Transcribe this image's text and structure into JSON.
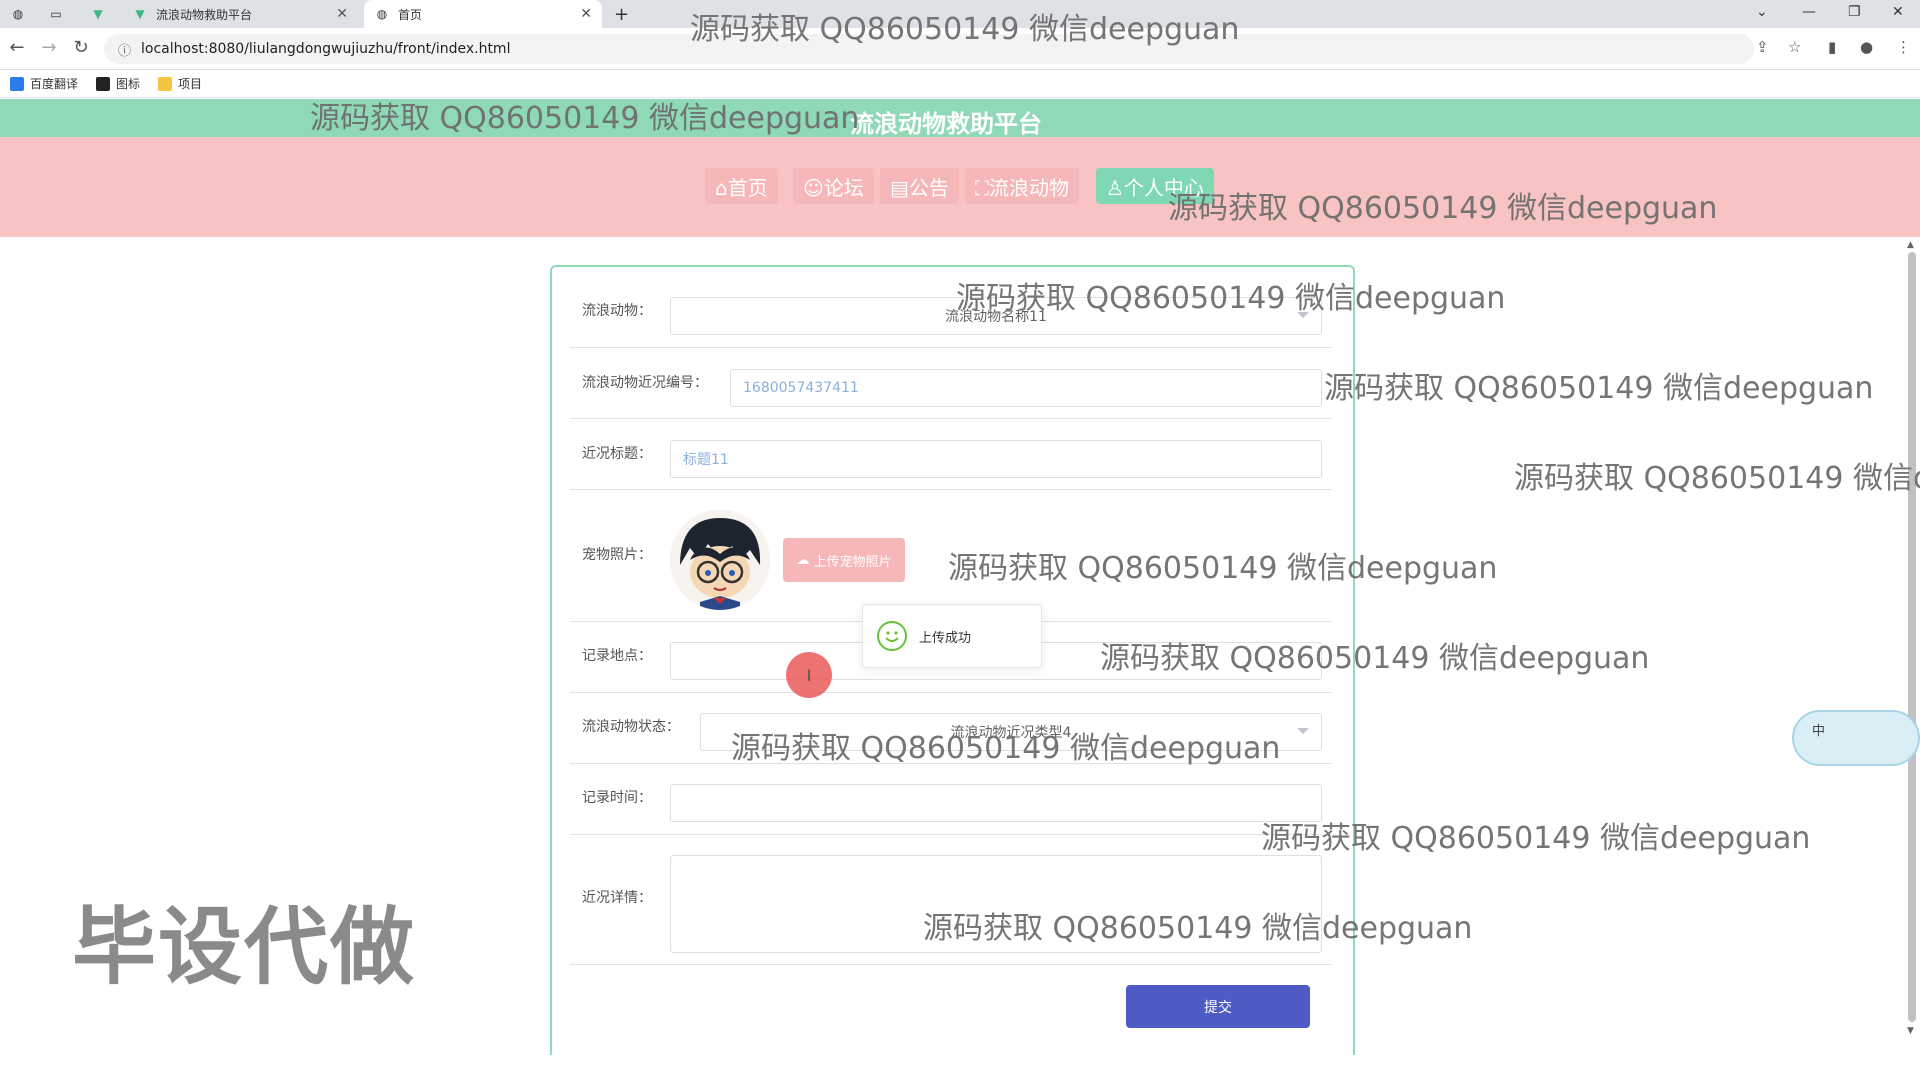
{
  "browser": {
    "tabs": [
      {
        "title": "",
        "icon": "globe-icon"
      },
      {
        "title": "",
        "icon": "blank-page-icon"
      },
      {
        "title": "",
        "icon": "vue-icon"
      },
      {
        "title": "流浪动物救助平台",
        "icon": "vue-icon"
      },
      {
        "title": "首页",
        "icon": "globe-icon"
      }
    ],
    "new_tab": "+",
    "url": "localhost:8080/liulangdongwujiuzhu/front/index.html",
    "bookmarks": [
      {
        "label": "百度翻译",
        "color": "#2b7de9"
      },
      {
        "label": "图标",
        "color": "#222222"
      },
      {
        "label": "项目",
        "color": "#f4c542"
      }
    ]
  },
  "site": {
    "title": "流浪动物救助平台",
    "nav": [
      {
        "label": "⌂首页",
        "active": false
      },
      {
        "label": "☺论坛",
        "active": false
      },
      {
        "label": "▤公告",
        "active": false
      },
      {
        "label": "⛶流浪动物",
        "active": false
      },
      {
        "label": "♙个人中心",
        "active": true
      }
    ]
  },
  "form": {
    "animal": {
      "label": "流浪动物：",
      "value": "流浪动物名称11"
    },
    "code": {
      "label": "流浪动物近况编号：",
      "value": "1680057437411"
    },
    "title": {
      "label": "近况标题：",
      "value": "标题11"
    },
    "photo": {
      "label": "宠物照片：",
      "upload_label": "上传宠物照片"
    },
    "location": {
      "label": "记录地点：",
      "value": ""
    },
    "status": {
      "label": "流浪动物状态：",
      "value": "流浪动物近况类型4"
    },
    "time": {
      "label": "记录时间：",
      "value": ""
    },
    "detail": {
      "label": "近况详情：",
      "value": ""
    },
    "submit_label": "提交"
  },
  "toast": {
    "message": "上传成功"
  },
  "widget": {
    "label": "中"
  },
  "overlay": {
    "big_text": "毕设代做",
    "watermark": "源码获取 QQ86050149 微信deepguan"
  },
  "colors": {
    "header_green": "#8fd9b6",
    "nav_pink": "#f8c3c3",
    "submit_blue": "#4e5bc5",
    "success_green": "#67c23a"
  }
}
